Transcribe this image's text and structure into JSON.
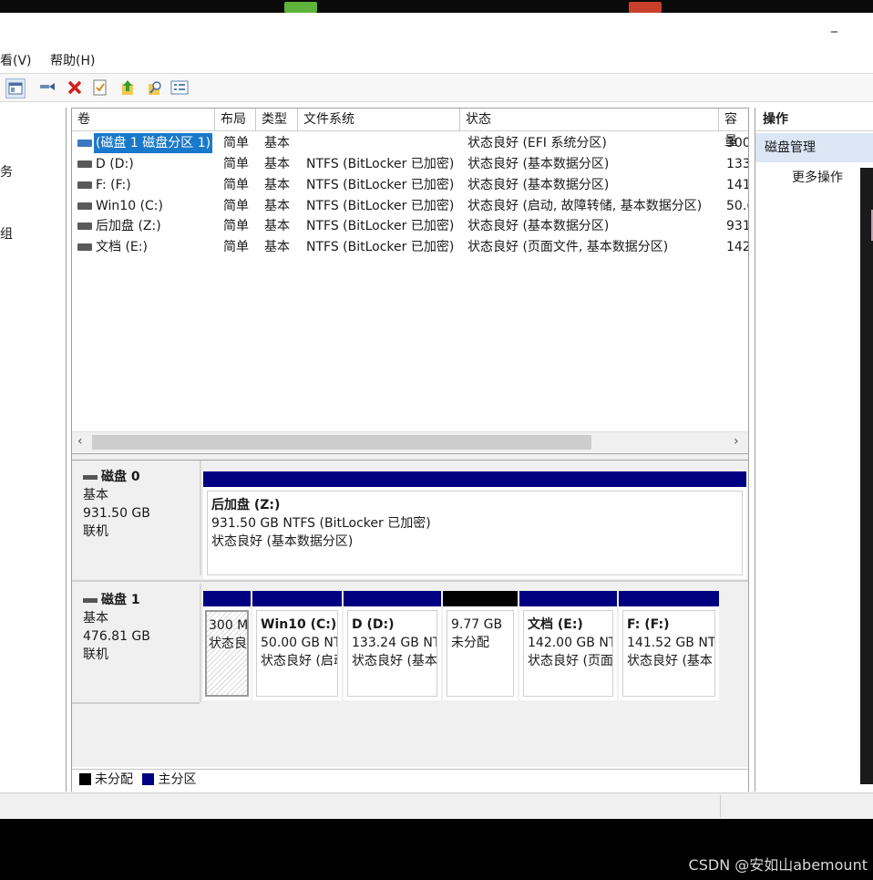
{
  "menu": [
    {
      "label": "看(V)"
    },
    {
      "label": "帮助(H)"
    }
  ],
  "window": {
    "minimize_glyph": "_"
  },
  "toolbar": {
    "icons": [
      "console-tree-icon",
      "connect-icon",
      "delete-icon",
      "properties-icon",
      "up-icon",
      "search-icon",
      "help-icon"
    ]
  },
  "left_pane": {
    "glyphs": [
      "务",
      "组"
    ]
  },
  "volume_table": {
    "columns": [
      "卷",
      "布局",
      "类型",
      "文件系统",
      "状态",
      "容量"
    ],
    "rows": [
      {
        "name": "(磁盘 1 磁盘分区 1)",
        "layout": "简单",
        "type": "基本",
        "fs": "",
        "status": "状态良好 (EFI 系统分区)",
        "capacity": "300",
        "selected": true
      },
      {
        "name": "D (D:)",
        "layout": "简单",
        "type": "基本",
        "fs": "NTFS (BitLocker 已加密)",
        "status": "状态良好 (基本数据分区)",
        "capacity": "133",
        "selected": false
      },
      {
        "name": "F:  (F:)",
        "layout": "简单",
        "type": "基本",
        "fs": "NTFS (BitLocker 已加密)",
        "status": "状态良好 (基本数据分区)",
        "capacity": "141",
        "selected": false
      },
      {
        "name": "Win10 (C:)",
        "layout": "简单",
        "type": "基本",
        "fs": "NTFS (BitLocker 已加密)",
        "status": "状态良好 (启动, 故障转储, 基本数据分区)",
        "capacity": "50.(",
        "selected": false
      },
      {
        "name": "后加盘 (Z:)",
        "layout": "简单",
        "type": "基本",
        "fs": "NTFS (BitLocker 已加密)",
        "status": "状态良好 (基本数据分区)",
        "capacity": "931",
        "selected": false
      },
      {
        "name": "文档 (E:)",
        "layout": "简单",
        "type": "基本",
        "fs": "NTFS (BitLocker 已加密)",
        "status": "状态良好 (页面文件, 基本数据分区)",
        "capacity": "142",
        "selected": false
      }
    ],
    "scroll_left": "‹",
    "scroll_right": "›"
  },
  "disks": [
    {
      "title": "磁盘 0",
      "type": "基本",
      "size": "931.50 GB",
      "state": "联机",
      "partitions": [
        {
          "name": "后加盘  (Z:)",
          "line1": "931.50 GB NTFS (BitLocker 已加密)",
          "line2": "状态良好 (基本数据分区)"
        }
      ]
    },
    {
      "title": "磁盘 1",
      "type": "基本",
      "size": "476.81 GB",
      "state": "联机",
      "partitions": [
        {
          "name": "",
          "line1": "300 M",
          "line2": "状态良"
        },
        {
          "name": "Win10  (C:)",
          "line1": "50.00 GB NTFS",
          "line2": "状态良好 (启动"
        },
        {
          "name": "D  (D:)",
          "line1": "133.24 GB NTFS",
          "line2": "状态良好 (基本"
        },
        {
          "name": "",
          "line1": "9.77 GB",
          "line2": "未分配"
        },
        {
          "name": "文档  (E:)",
          "line1": "142.00 GB NTFS",
          "line2": "状态良好 (页面"
        },
        {
          "name": "F:   (F:)",
          "line1": "141.52 GB NTFS",
          "line2": "状态良好 (基本"
        }
      ]
    }
  ],
  "legend": [
    {
      "label": "未分配",
      "color": "#000000"
    },
    {
      "label": "主分区",
      "color": "#000080"
    }
  ],
  "actions": {
    "header": "操作",
    "selected": "磁盘管理",
    "more": "更多操作"
  },
  "watermark": "CSDN @安如山abemount"
}
